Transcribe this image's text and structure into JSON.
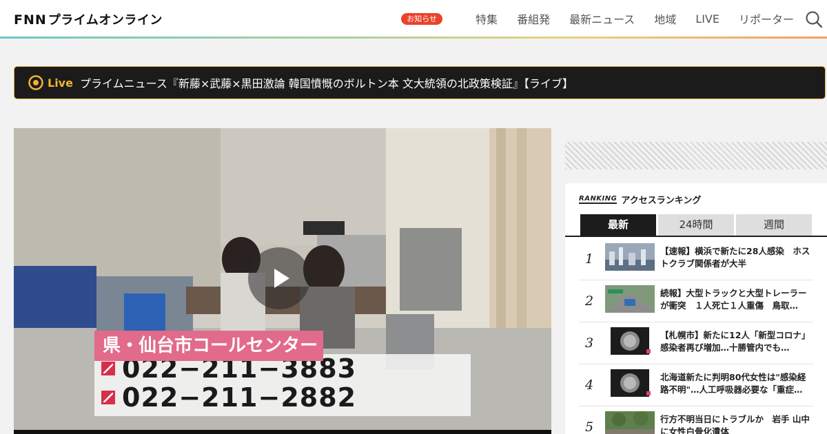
{
  "header": {
    "logo_mark": "FNN",
    "logo_text": "プライムオンライン",
    "notice_badge": "お知らせ",
    "nav": [
      "特集",
      "番組発",
      "最新ニュース",
      "地域",
      "LIVE",
      "リポーター"
    ]
  },
  "live": {
    "label": "Live",
    "title": "プライムニュース『新藤×武藤×黒田激論 韓国憤慨のボルトン本 文大統領の北政策検証』【ライブ】"
  },
  "video": {
    "caption_title": "県・仙台市コールセンター",
    "phones": [
      "022−211−3883",
      "022−211−2882"
    ]
  },
  "ranking": {
    "logo": "RANKING",
    "title": "アクセスランキング",
    "tabs": [
      "最新",
      "24時間",
      "週間"
    ],
    "active_tab": "最新",
    "items": [
      {
        "rank": "1",
        "title": "【速報】横浜で新たに28人感染　ホストクラブ関係者が大半"
      },
      {
        "rank": "2",
        "title": "続報】大型トラックと大型トレーラーが衝突　１人死亡１人重傷　鳥取…"
      },
      {
        "rank": "3",
        "title": "【札幌市】新たに12人「新型コロナ」感染者再び増加…十勝管内でも…"
      },
      {
        "rank": "4",
        "title": "北海道新たに判明80代女性は\"感染経路不明\"…人工呼吸器必要な「重症…"
      },
      {
        "rank": "5",
        "title": "行方不明当日にトラブルか　岩手 山中に女性白骨化遺体"
      }
    ]
  },
  "colors": {
    "accent_badge": "#e9442a",
    "live_gold": "#f3b332",
    "caption_pink": "#e26a8a"
  }
}
